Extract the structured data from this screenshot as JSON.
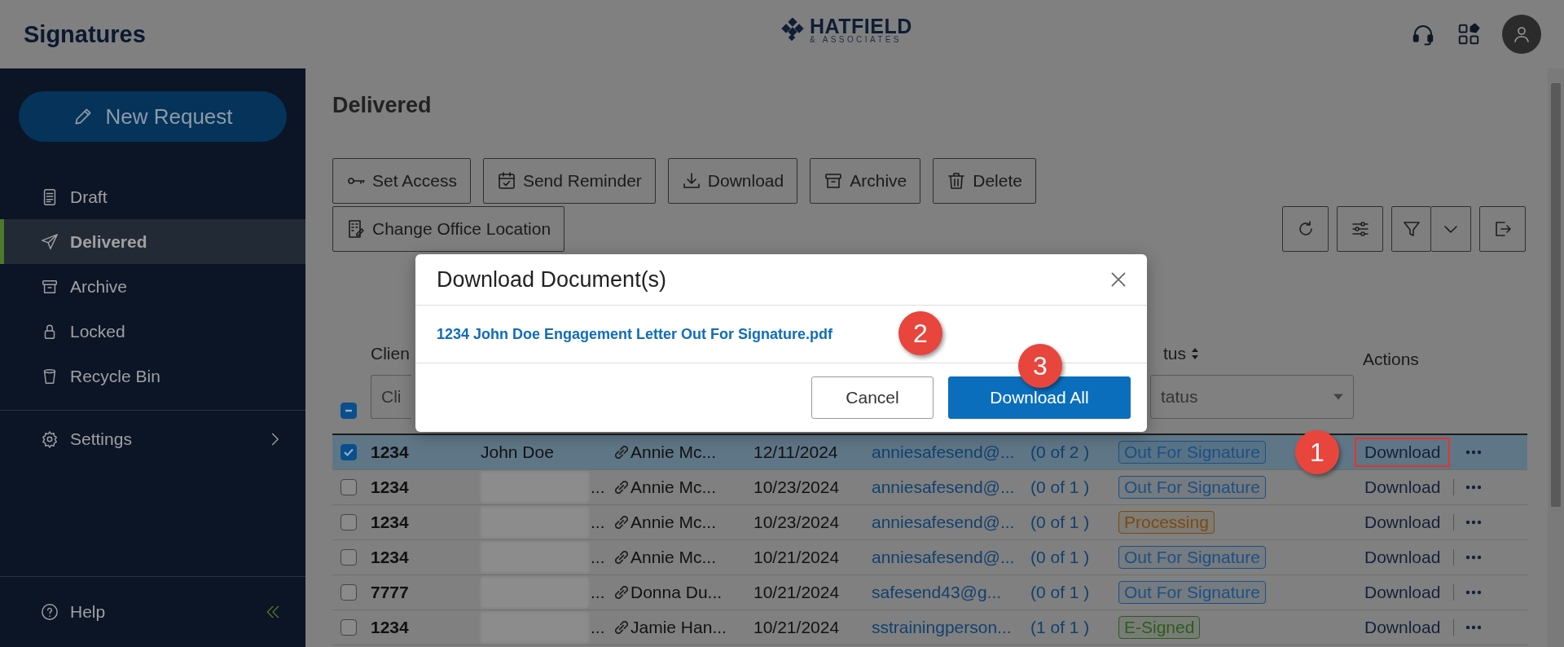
{
  "app": {
    "title": "Signatures",
    "logo": {
      "name": "HATFIELD",
      "tagline": "& ASSOCIATES"
    }
  },
  "sidebar": {
    "new_button": "New Request",
    "items": [
      {
        "label": "Draft",
        "selected": false
      },
      {
        "label": "Delivered",
        "selected": true
      },
      {
        "label": "Archive",
        "selected": false
      },
      {
        "label": "Locked",
        "selected": false
      },
      {
        "label": "Recycle Bin",
        "selected": false
      }
    ],
    "settings": "Settings",
    "help": "Help"
  },
  "page": {
    "heading": "Delivered",
    "actions": [
      "Set Access",
      "Send Reminder",
      "Download",
      "Archive",
      "Delete",
      "Change Office Location"
    ]
  },
  "table": {
    "select_all": {
      "indeterminate": true
    },
    "columns": [
      {
        "label": "Clien",
        "sortable": false
      },
      {
        "label": "tus",
        "sortable": true
      },
      {
        "label": "Actions",
        "sortable": false
      }
    ],
    "filters": [
      {
        "placeholder": "Cli",
        "dropdown": false
      },
      {
        "placeholder": "tatus",
        "dropdown": true
      }
    ],
    "rows": [
      {
        "checked": true,
        "id": "1234",
        "client": "John Doe",
        "client_blurred": false,
        "signer": "Annie Mc...",
        "date": "12/11/2024",
        "email": "anniesafesend@...",
        "count": "(0 of 2 )",
        "status": {
          "label": "Out For Signature",
          "color": "#1d4f82"
        },
        "action": "Download",
        "action_highlighted": true
      },
      {
        "checked": false,
        "id": "1234",
        "client": "...",
        "client_blurred": true,
        "signer": "Annie Mc...",
        "date": "10/23/2024",
        "email": "anniesafesend@...",
        "count": "(0 of 1 )",
        "status": {
          "label": "Out For Signature",
          "color": "#1d4f82"
        },
        "action": "Download",
        "action_highlighted": false
      },
      {
        "checked": false,
        "id": "1234",
        "client": "...",
        "client_blurred": true,
        "signer": "Annie Mc...",
        "date": "10/23/2024",
        "email": "anniesafesend@...",
        "count": "(0 of 1 )",
        "status": {
          "label": "Processing",
          "color": "#7a4a12"
        },
        "action": "Download",
        "action_highlighted": false
      },
      {
        "checked": false,
        "id": "1234",
        "client": "...",
        "client_blurred": true,
        "signer": "Annie Mc...",
        "date": "10/21/2024",
        "email": "anniesafesend@...",
        "count": "(0 of 1 )",
        "status": {
          "label": "Out For Signature",
          "color": "#1d4f82"
        },
        "action": "Download",
        "action_highlighted": false
      },
      {
        "checked": false,
        "id": "7777",
        "client": "...",
        "client_blurred": true,
        "signer": "Donna Du...",
        "date": "10/21/2024",
        "email": "safesend43@g...",
        "count": "(0 of 1 )",
        "status": {
          "label": "Out For Signature",
          "color": "#1d4f82"
        },
        "action": "Download",
        "action_highlighted": false
      },
      {
        "checked": false,
        "id": "1234",
        "client": "...",
        "client_blurred": true,
        "signer": "Jamie Han...",
        "date": "10/21/2024",
        "email": "sstrainingperson...",
        "count": "(1 of 1 )",
        "status": {
          "label": "E-Signed",
          "color": "#2f5a1f"
        },
        "action": "Download",
        "action_highlighted": false
      }
    ]
  },
  "modal": {
    "title": "Download Document(s)",
    "files": [
      "1234 John Doe Engagement Letter Out For Signature.pdf"
    ],
    "buttons": [
      {
        "label": "Cancel",
        "kind": "secondary"
      },
      {
        "label": "Download All",
        "kind": "primary"
      }
    ]
  },
  "annotations": [
    {
      "number": "1"
    },
    {
      "number": "2"
    },
    {
      "number": "3"
    }
  ]
}
